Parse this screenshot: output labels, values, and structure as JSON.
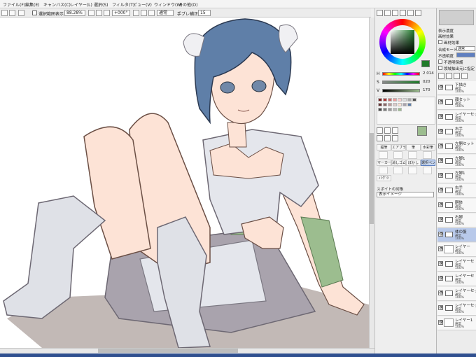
{
  "menu": [
    "ファイル(F)",
    "編集(E)",
    "キャンバス(C)",
    "レイヤー(L)",
    "選択(S)",
    "フィルタ(T)",
    "ビュー(V)",
    "ウィンドウ(W)",
    "その他(O)"
  ],
  "toolbar": {
    "show_selection_label": "選択範囲表示",
    "zoom_value": "88.28%",
    "rotation_value": "+000°",
    "blend_value": "通常",
    "stabilizer_label": "手ブレ補正",
    "stabilizer_value": "15"
  },
  "colors": {
    "accent_blue": "#2f4f8f",
    "wheel_selected": "#1f7a2a",
    "layer_selected_bg": "#b8c9ea",
    "hair": "#5f7fa8",
    "skin": "#fde3d6",
    "cloth_shadow": "#a9a3ad",
    "sleeve_green": "#9cbd8f",
    "cast_shadow": "#b7ada9"
  },
  "color_panel": {
    "h_value": "2 014",
    "s_value": "020",
    "v_value": "170"
  },
  "tools": {
    "row1": [
      "鉛筆",
      "エアブラシ",
      "筆",
      "水彩筆"
    ],
    "row2": [
      "マーカー",
      "消しゴム",
      "ぼかし",
      "選択ペン"
    ],
    "row3": [
      "バケツ"
    ],
    "tool_selected": "選択ペン",
    "brush_name": "スポイトの対象",
    "brush_target": "表示イメージ"
  },
  "layer_panel": {
    "texture_label": "表示濃度",
    "effect_label": "画材効果",
    "texture_check_label": "画材効果",
    "mode_label": "合成モード",
    "mode_value": "通常",
    "opacity_label": "不透明度",
    "protect_label": "不透明保護",
    "clip_label": "下のレイヤーでクリッピング",
    "clip_short": "下",
    "select_source_label": "領域抽出元に指定"
  },
  "layers": [
    {
      "name": "下描き",
      "mode": "通常",
      "opacity": "100%",
      "type": "folder"
    },
    {
      "name": "顔セット",
      "mode": "通常",
      "opacity": "100%",
      "type": "folder"
    },
    {
      "name": "レイヤーセット",
      "mode": "通常",
      "opacity": "100%",
      "type": "folder"
    },
    {
      "name": "右手",
      "mode": "通常",
      "opacity": "100%",
      "type": "folder"
    },
    {
      "name": "左胴セット",
      "mode": "通常",
      "opacity": "100%",
      "type": "folder"
    },
    {
      "name": "左脚1",
      "mode": "通常",
      "opacity": "100%",
      "type": "folder"
    },
    {
      "name": "左脚1",
      "mode": "通常",
      "opacity": "100%",
      "type": "folder"
    },
    {
      "name": "右手",
      "mode": "通常",
      "opacity": "100%",
      "type": "folder"
    },
    {
      "name": "胴体",
      "mode": "通常",
      "opacity": "100%",
      "type": "folder"
    },
    {
      "name": "右脚",
      "mode": "通常",
      "opacity": "100%",
      "type": "folder"
    },
    {
      "name": "体の服",
      "mode": "通常",
      "opacity": "100%",
      "type": "folder",
      "selected": true
    },
    {
      "name": "レイヤー",
      "mode": "通常",
      "opacity": "100%",
      "type": "layer"
    },
    {
      "name": "レイヤーセ",
      "mode": "通常",
      "opacity": "100%",
      "type": "folder"
    },
    {
      "name": "レイヤーセ",
      "mode": "通常",
      "opacity": "100%",
      "type": "folder"
    },
    {
      "name": "レイヤーセット",
      "mode": "通常",
      "opacity": "100%",
      "type": "folder"
    },
    {
      "name": "レイヤーセット",
      "mode": "通常",
      "opacity": "100%",
      "type": "folder"
    },
    {
      "name": "レイヤー1",
      "mode": "通常",
      "opacity": "100%",
      "type": "layer"
    }
  ]
}
